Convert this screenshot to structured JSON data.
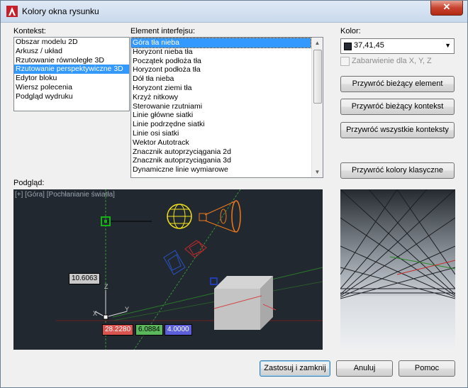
{
  "window": {
    "title": "Kolory okna rysunku"
  },
  "context": {
    "label": "Kontekst:",
    "items": [
      "Obszar modelu 2D",
      "Arkusz / układ",
      "Rzutowanie równoległe 3D",
      "Rzutowanie perspektywiczne 3D",
      "Edytor bloku",
      "Wiersz polecenia",
      "Podgląd wydruku"
    ],
    "selected_index": 3
  },
  "element": {
    "label": "Element interfejsu:",
    "items": [
      "Góra tła nieba",
      "Horyzont nieba tła",
      "Początek podłoża tła",
      "Horyzont podłoża tła",
      "Dół tła nieba",
      "Horyzont ziemi tła",
      "Krzyż nitkowy",
      "Sterowanie rzutniami",
      "Linie główne siatki",
      "Linie podrzędne siatki",
      "Linie osi siatki",
      "Wektor Autotrack",
      "Znacznik autoprzyciągania 2d",
      "Znacznik autoprzyciągania 3d",
      "Dynamiczne linie wymiarowe"
    ],
    "selected_index": 0
  },
  "color": {
    "label": "Kolor:",
    "value": "37,41,45",
    "swatch": "#252933",
    "tint_label": "Zabarwienie dla X, Y, Z",
    "tint_checked": false
  },
  "buttons": {
    "restore_element": "Przywróć bieżący element",
    "restore_context": "Przywróć bieżący kontekst",
    "restore_all": "Przywróć wszystkie konteksty",
    "restore_classic": "Przywróć kolory klasyczne",
    "apply_close": "Zastosuj i zamknij",
    "cancel": "Anuluj",
    "help": "Pomoc"
  },
  "preview": {
    "label": "Podgląd:",
    "viewport_title": "[+] [Góra] [Pochłanianie światła]",
    "dim_value": "10.6063",
    "coord_x": "28.2280",
    "coord_y": "6.0884",
    "coord_z": "4.0000",
    "axis_z": "Z",
    "axis_y": "Y",
    "axis_x": "X"
  },
  "colors": {
    "accent": "#3399ff",
    "preview_bg": "#212830",
    "coord_x_bg": "#d9534f",
    "coord_y_bg": "#5cb85c",
    "coord_z_bg": "#5b5fd9"
  }
}
